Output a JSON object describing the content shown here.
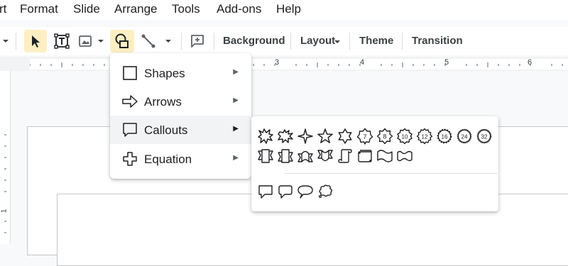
{
  "menubar": {
    "items": [
      "rt",
      "Format",
      "Slide",
      "Arrange",
      "Tools",
      "Add-ons",
      "Help"
    ]
  },
  "toolbar": {
    "background_label": "Background",
    "layout_label": "Layout",
    "theme_label": "Theme",
    "transition_label": "Transition",
    "icons": [
      "dropdown-arrow-icon",
      "select-cursor-icon",
      "text-box-icon",
      "image-icon",
      "shape-icon",
      "line-icon",
      "comment-icon"
    ],
    "active_tool": "shape-icon",
    "active_color": "#fdefc3"
  },
  "ruler": {
    "numbers": [
      "3",
      "4",
      "5",
      "6"
    ],
    "vertical_number": "1"
  },
  "insert_menu": {
    "items": [
      {
        "label": "Shapes",
        "icon": "square-icon",
        "arrow": "▶"
      },
      {
        "label": "Arrows",
        "icon": "arrow-right-outline-icon",
        "arrow": "▶"
      },
      {
        "label": "Callouts",
        "icon": "speech-bubble-icon",
        "arrow": "▶"
      },
      {
        "label": "Equation",
        "icon": "plus-outline-icon",
        "arrow": "▶"
      }
    ],
    "highlighted": "Callouts"
  },
  "callouts_submenu": {
    "row1": [
      "explosion-1",
      "explosion-2",
      "star-4",
      "star-5",
      "star-6",
      "star-7",
      "star-8",
      "star-10",
      "star-12",
      "star-16",
      "star-24",
      "star-32"
    ],
    "star_labels": [
      "7",
      "8",
      "10",
      "12",
      "16",
      "24",
      "32"
    ],
    "row2": [
      "ribbon-1",
      "ribbon-2",
      "ellipse-ribbon-1",
      "ellipse-ribbon-2",
      "vertical-scroll",
      "horizontal-scroll",
      "wave",
      "double-wave"
    ],
    "row3": [
      "rectangular-callout",
      "rounded-rectangular-callout",
      "oval-callout",
      "cloud-callout"
    ]
  }
}
